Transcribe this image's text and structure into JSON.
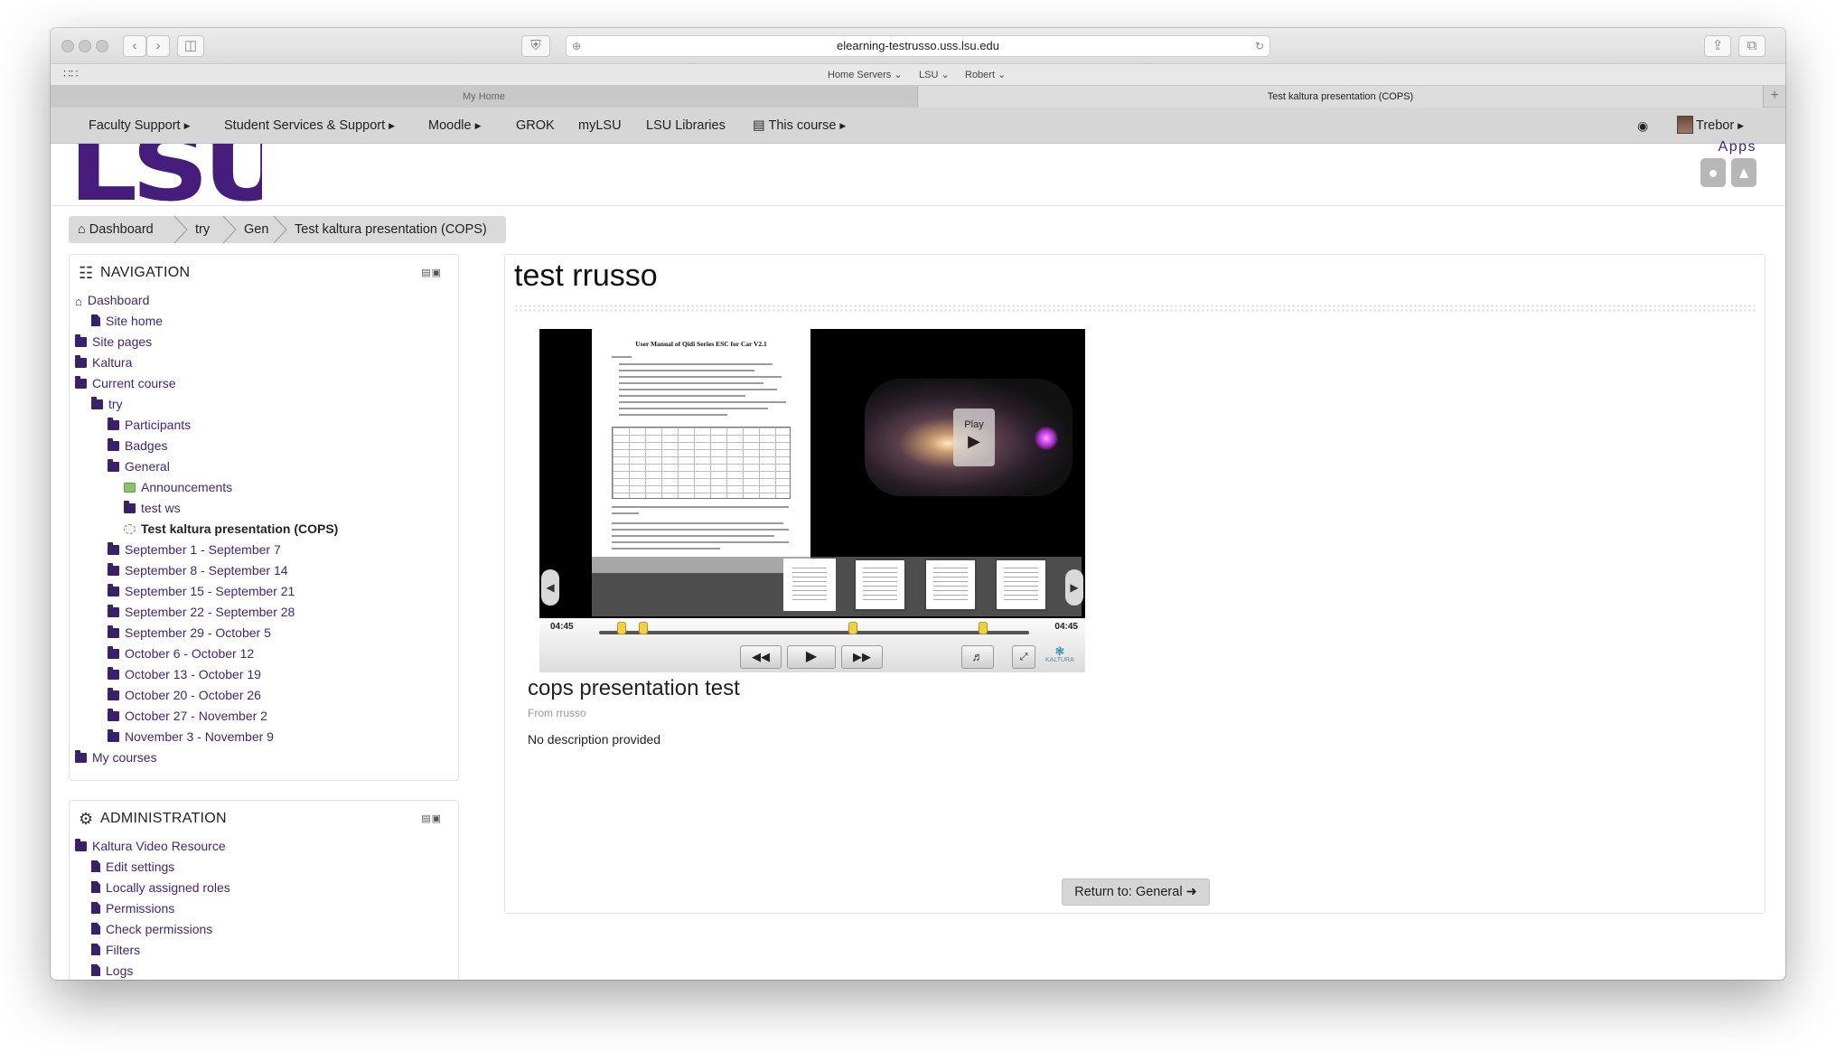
{
  "browser": {
    "url": "elearning-testrusso.uss.lsu.edu",
    "bookmarks": [
      "Home Servers",
      "LSU",
      "Robert"
    ],
    "tabs": [
      {
        "label": "My Home",
        "active": false
      },
      {
        "label": "Test kaltura presentation (COPS)",
        "active": true
      }
    ]
  },
  "sitenav": {
    "items": [
      "Faculty Support",
      "Student Services & Support",
      "Moodle",
      "GROK",
      "myLSU",
      "LSU Libraries",
      "This course"
    ],
    "user": "Trebor"
  },
  "header": {
    "logo_text": "LSU",
    "apps_label": "Apps"
  },
  "breadcrumb": [
    "Dashboard",
    "try",
    "Gen",
    "Test kaltura presentation (COPS)"
  ],
  "navigation": {
    "title": "NAVIGATION",
    "items": [
      {
        "label": "Dashboard",
        "icon": "home-icon"
      },
      {
        "label": "Site home",
        "icon": "file-icon"
      },
      {
        "label": "Site pages",
        "icon": "folder-icon"
      },
      {
        "label": "Kaltura",
        "icon": "folder-icon"
      },
      {
        "label": "Current course",
        "icon": "folder-open-icon"
      },
      {
        "label": "try",
        "icon": "folder-open-icon"
      },
      {
        "label": "Participants",
        "icon": "folder-icon"
      },
      {
        "label": "Badges",
        "icon": "folder-icon"
      },
      {
        "label": "General",
        "icon": "folder-open-icon"
      },
      {
        "label": "Announcements",
        "icon": "forum-icon"
      },
      {
        "label": "test ws",
        "icon": "folder-icon"
      },
      {
        "label": "Test kaltura presentation (COPS)",
        "icon": "kaltura-icon"
      },
      {
        "label": "September 1 - September 7",
        "icon": "folder-icon"
      },
      {
        "label": "September 8 - September 14",
        "icon": "folder-icon"
      },
      {
        "label": "September 15 - September 21",
        "icon": "folder-icon"
      },
      {
        "label": "September 22 - September 28",
        "icon": "folder-icon"
      },
      {
        "label": "September 29 - October 5",
        "icon": "folder-icon"
      },
      {
        "label": "October 6 - October 12",
        "icon": "folder-icon"
      },
      {
        "label": "October 13 - October 19",
        "icon": "folder-icon"
      },
      {
        "label": "October 20 - October 26",
        "icon": "folder-icon"
      },
      {
        "label": "October 27 - November 2",
        "icon": "folder-icon"
      },
      {
        "label": "November 3 - November 9",
        "icon": "folder-icon"
      },
      {
        "label": "My courses",
        "icon": "folder-icon"
      }
    ]
  },
  "administration": {
    "title": "ADMINISTRATION",
    "items": [
      {
        "label": "Kaltura Video Resource",
        "icon": "folder-open-icon"
      },
      {
        "label": "Edit settings",
        "icon": "file-icon"
      },
      {
        "label": "Locally assigned roles",
        "icon": "file-icon"
      },
      {
        "label": "Permissions",
        "icon": "file-icon"
      },
      {
        "label": "Check permissions",
        "icon": "file-icon"
      },
      {
        "label": "Filters",
        "icon": "file-icon"
      },
      {
        "label": "Logs",
        "icon": "file-icon"
      }
    ]
  },
  "main": {
    "title": "test rrusso",
    "player": {
      "doc_title": "User Manual of Qidi Series ESC for Car V2.1",
      "play_label": "Play",
      "time_elapsed": "04:45",
      "time_total": "04:45",
      "brand": "KALTURA"
    },
    "media_title": "cops presentation test",
    "media_from": "From rrusso",
    "media_description": "No description provided",
    "return_button": "Return to: General"
  },
  "colors": {
    "brand_purple": "#461d7c",
    "link": "#46247a",
    "nav_bg": "#d6d6d6"
  }
}
